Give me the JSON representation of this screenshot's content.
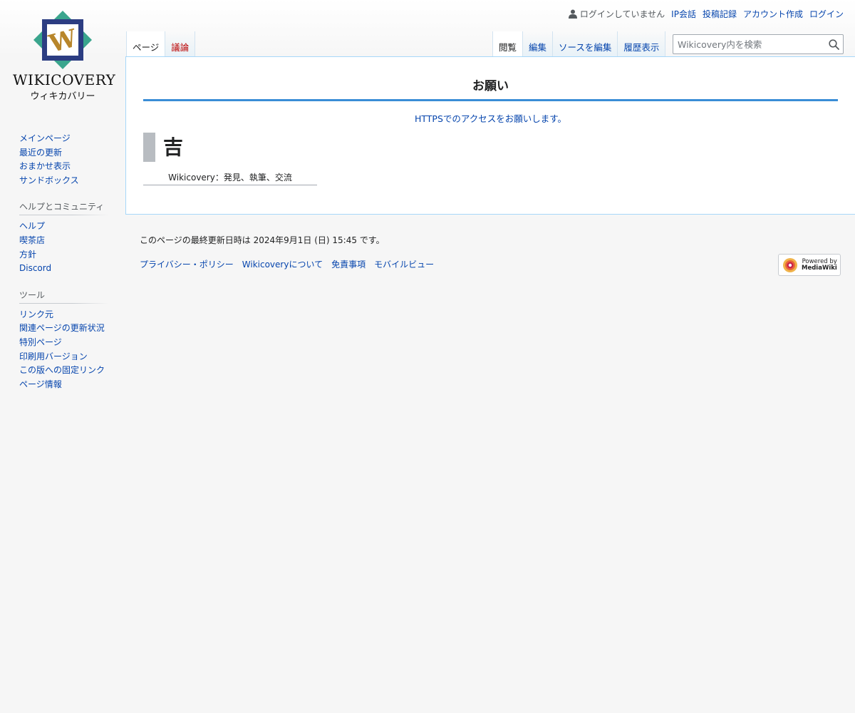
{
  "personal": {
    "anon_text": "ログインしていません",
    "links": [
      "IP会話",
      "投稿記録",
      "アカウント作成",
      "ログイン"
    ]
  },
  "logo": {
    "wordmark": "WIKICOVERY",
    "tagline": "ウィキカバリー",
    "letter": "W"
  },
  "sidebar": {
    "navigation": [
      "メインページ",
      "最近の更新",
      "おまかせ表示",
      "サンドボックス"
    ],
    "community": {
      "title": "ヘルプとコミュニティ",
      "items": [
        "ヘルプ",
        "喫茶店",
        "方針",
        "Discord"
      ]
    },
    "tools": {
      "title": "ツール",
      "items": [
        "リンク元",
        "関連ページの更新状況",
        "特別ページ",
        "印刷用バージョン",
        "この版への固定リンク",
        "ページ情報"
      ]
    }
  },
  "tabs": {
    "left": [
      "ページ",
      "議論"
    ],
    "right": [
      "閲覧",
      "編集",
      "ソースを編集",
      "履歴表示"
    ]
  },
  "search": {
    "placeholder": "Wikicovery内を検索"
  },
  "content": {
    "notice_title": "お願い",
    "notice_link": "HTTPSでのアクセスをお願いします。",
    "heading": "吉",
    "tagline": "Wikicovery：発見、執筆、交流"
  },
  "footer": {
    "lastmod": "このページの最終更新日時は 2024年9月1日 (日) 15:45 です。",
    "links": [
      "プライバシー・ポリシー",
      "Wikicoveryについて",
      "免責事項",
      "モバイルビュー"
    ],
    "powered_line1": "Powered by",
    "powered_line2": "MediaWiki"
  },
  "colors": {
    "link": "#0645ad",
    "new_link": "#ba0000",
    "accent_rule": "#3a8dd6",
    "logo_teal": "#3aa58d",
    "logo_navy": "#2c3d82",
    "logo_gold": "#b8862b"
  }
}
